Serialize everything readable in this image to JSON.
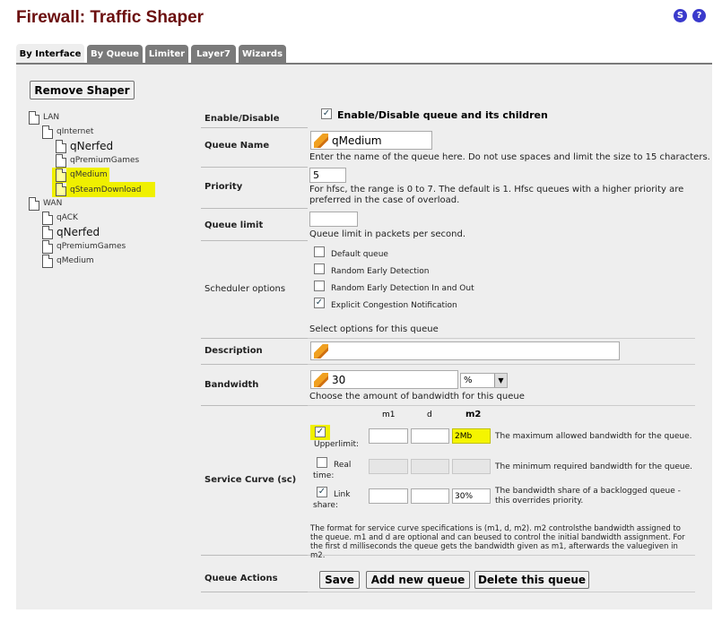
{
  "page": {
    "title": "Firewall: Traffic Shaper"
  },
  "header_icons": {
    "status_icon": "S",
    "help_icon": "?"
  },
  "tabs": [
    {
      "label": "By Interface",
      "active": true
    },
    {
      "label": "By Queue",
      "active": false
    },
    {
      "label": "Limiter",
      "active": false
    },
    {
      "label": "Layer7",
      "active": false
    },
    {
      "label": "Wizards",
      "active": false
    }
  ],
  "remove_shaper_label": "Remove Shaper",
  "tree": [
    {
      "label": "LAN",
      "size": "small",
      "highlight": false
    },
    {
      "label": "qInternet",
      "size": "small",
      "highlight": false
    },
    {
      "label": "qNerfed",
      "size": "big",
      "highlight": false
    },
    {
      "label": "qPremiumGames",
      "size": "small",
      "highlight": false
    },
    {
      "label": "qMedium",
      "size": "small",
      "highlight": true
    },
    {
      "label": "qSteamDownload",
      "size": "small",
      "highlight": true
    },
    {
      "label": "WAN",
      "size": "small",
      "highlight": false
    },
    {
      "label": "qACK",
      "size": "small",
      "highlight": false
    },
    {
      "label": "qNerfed",
      "size": "big",
      "highlight": false
    },
    {
      "label": "qPremiumGames",
      "size": "small",
      "highlight": false
    },
    {
      "label": "qMedium",
      "size": "small",
      "highlight": false
    }
  ],
  "form": {
    "enable": {
      "label": "Enable/Disable",
      "checkbox_label": "Enable/Disable queue and its children",
      "checked": true
    },
    "queue_name": {
      "label": "Queue Name",
      "value": "qMedium",
      "help": "Enter the name of the queue here. Do not use spaces and limit the size to 15 characters."
    },
    "priority": {
      "label": "Priority",
      "value": "5",
      "help": "For hfsc, the range is 0 to 7. The default is 1. Hfsc queues with a higher priority are preferred in the case of overload."
    },
    "queue_limit": {
      "label": "Queue limit",
      "value": "",
      "help": "Queue limit in packets per second."
    },
    "scheduler": {
      "label": "Scheduler options",
      "options": [
        {
          "label": "Default queue",
          "checked": false
        },
        {
          "label": "Random Early Detection",
          "checked": false
        },
        {
          "label": "Random Early Detection In and Out",
          "checked": false
        },
        {
          "label": "Explicit Congestion Notification",
          "checked": true
        }
      ],
      "help": "Select options for this queue"
    },
    "description": {
      "label": "Description",
      "value": ""
    },
    "bandwidth": {
      "label": "Bandwidth",
      "value": "30",
      "unit": "%",
      "help": "Choose the amount of bandwidth for this queue"
    },
    "service_curve": {
      "label": "Service Curve (sc)",
      "col_m1": "m1",
      "col_d": "d",
      "col_m2": "m2",
      "upperlimit": {
        "label": "Upperlimit:",
        "checked": true,
        "m1": "",
        "d": "",
        "m2": "2Mb",
        "desc": "The maximum allowed bandwidth for the queue."
      },
      "realtime": {
        "label1": "Real",
        "label2": "time:",
        "checked": false,
        "m1": "",
        "d": "",
        "m2": "",
        "desc": "The minimum required bandwidth for the queue."
      },
      "linkshare": {
        "label1": "Link",
        "label2": "share:",
        "checked": true,
        "m1": "",
        "d": "",
        "m2": "30%",
        "desc": "The bandwidth share of a backlogged queue - this overrides priority."
      },
      "footnote": "The format for service curve specifications is (m1, d, m2). m2 controlsthe bandwidth assigned to the queue. m1 and d are optional and can beused to control the initial bandwidth assignment. For the first d milliseconds the queue gets the bandwidth given as m1, afterwards the valuegiven in m2."
    },
    "actions": {
      "label": "Queue Actions",
      "save": "Save",
      "add_new": "Add new queue",
      "delete": "Delete this queue"
    }
  },
  "colors": {
    "title": "#6b0e0e",
    "tab": "#7a7a7a",
    "panel": "#eeeeee",
    "highlight": "#f0f000"
  }
}
